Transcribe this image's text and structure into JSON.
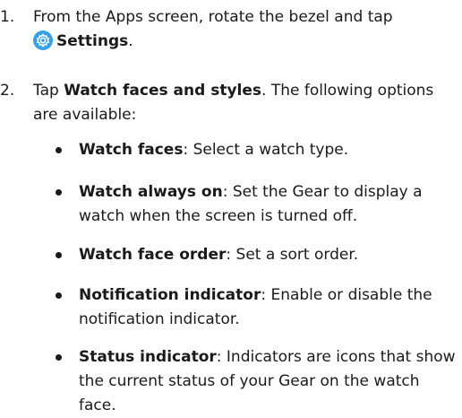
{
  "steps": [
    {
      "number": "1.",
      "text_before": "From the Apps screen, rotate the bezel and tap",
      "bold": "Settings",
      "text_after": "."
    },
    {
      "number": "2.",
      "text_before": "Tap ",
      "bold": "Watch faces and styles",
      "text_after": ". The following options are available:"
    }
  ],
  "bullets": [
    {
      "term": "Watch faces",
      "desc": ": Select a watch type."
    },
    {
      "term": "Watch always on",
      "desc": ": Set the Gear to display a watch when the screen is turned off."
    },
    {
      "term": "Watch face order",
      "desc": ": Set a sort order."
    },
    {
      "term": "Notification indicator",
      "desc": ": Enable or disable the notification indicator."
    },
    {
      "term": "Status indicator",
      "desc": ": Indicators are icons that show the current status of your Gear on the watch face."
    }
  ],
  "icons": {
    "settings": "gear-icon",
    "settings_color": "#3aa0e8"
  }
}
